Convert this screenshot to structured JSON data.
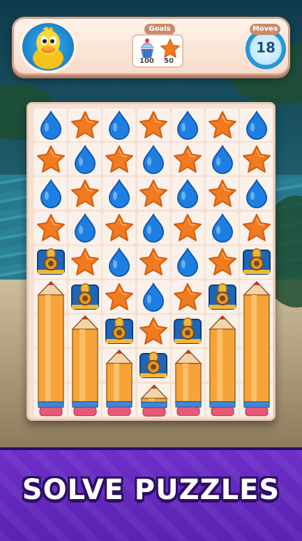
{
  "goals": {
    "label": "Goals",
    "items": [
      {
        "icon": "cupcake-icon",
        "count": "100"
      },
      {
        "icon": "star-icon",
        "count": "50"
      }
    ]
  },
  "moves": {
    "label": "Moves",
    "value": "18"
  },
  "board": {
    "columns": 7,
    "grid": [
      [
        "drop",
        "star",
        "drop",
        "star",
        "drop",
        "star",
        "drop"
      ],
      [
        "star",
        "drop",
        "star",
        "drop",
        "star",
        "drop",
        "star"
      ],
      [
        "drop",
        "star",
        "drop",
        "star",
        "drop",
        "star",
        "drop"
      ],
      [
        "star",
        "drop",
        "star",
        "drop",
        "star",
        "drop",
        "star"
      ],
      [
        "lock",
        "star",
        "drop",
        "star",
        "drop",
        "star",
        "lock"
      ],
      [
        "pencil",
        "lock",
        "star",
        "drop",
        "star",
        "lock",
        "pencil"
      ],
      [
        "pencil",
        "pencil",
        "lock",
        "star",
        "lock",
        "pencil",
        "pencil"
      ],
      [
        "pencil",
        "pencil",
        "pencil",
        "lock",
        "pencil",
        "pencil",
        "pencil"
      ],
      [
        "pencil",
        "pencil",
        "pencil",
        "pencil",
        "pencil",
        "pencil",
        "pencil"
      ]
    ],
    "pencils": [
      {
        "col": 0,
        "top_row": 5,
        "rows": 4
      },
      {
        "col": 1,
        "top_row": 6,
        "rows": 3
      },
      {
        "col": 2,
        "top_row": 7,
        "rows": 2
      },
      {
        "col": 3,
        "top_row": 8,
        "rows": 1
      },
      {
        "col": 4,
        "top_row": 7,
        "rows": 2
      },
      {
        "col": 5,
        "top_row": 6,
        "rows": 3
      },
      {
        "col": 6,
        "top_row": 5,
        "rows": 4
      }
    ]
  },
  "banner": {
    "text": "SOLVE PUZZLES"
  },
  "colors": {
    "drop": "#1e7fe3",
    "star": "#f27a1f",
    "pencil": "#f6a43a",
    "lock": "#1d66b8"
  }
}
